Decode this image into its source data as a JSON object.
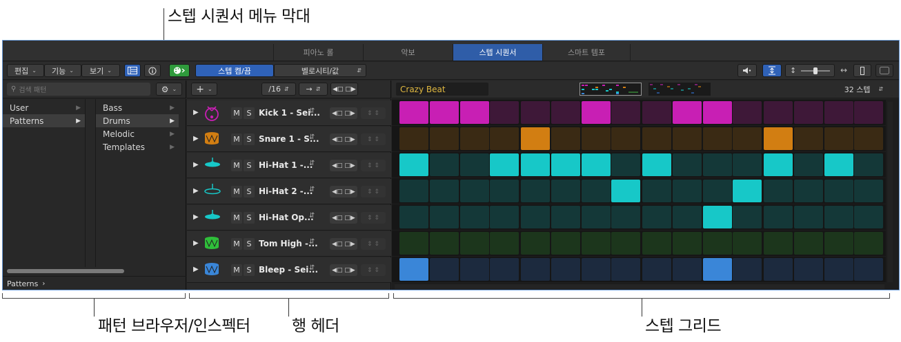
{
  "callouts": {
    "menubar": "스텝 시퀀서 메뉴 막대",
    "browser": "패턴 브라우저/인스펙터",
    "rowheader": "행 헤더",
    "grid": "스텝 그리드"
  },
  "tabs": [
    {
      "label": "피아노 롤",
      "active": false
    },
    {
      "label": "악보",
      "active": false
    },
    {
      "label": "스텝 시퀀서",
      "active": true
    },
    {
      "label": "스마트 템포",
      "active": false
    }
  ],
  "toolbar": {
    "edit": "편집",
    "functions": "기능",
    "view": "보기",
    "info_icon": "info-icon",
    "step_onoff": "스텝 켬/끔",
    "velocity": "벨로시티/값"
  },
  "browser": {
    "search_placeholder": "검색 패턴",
    "col1": [
      {
        "label": "User",
        "selected": false
      },
      {
        "label": "Patterns",
        "selected": true
      }
    ],
    "col2": [
      {
        "label": "Bass",
        "selected": false
      },
      {
        "label": "Drums",
        "selected": true
      },
      {
        "label": "Melodic",
        "selected": false
      },
      {
        "label": "Templates",
        "selected": false
      }
    ],
    "footer": "Patterns"
  },
  "rowheader_toolbar": {
    "add": "+",
    "step_rate": "/16",
    "arrow": "→"
  },
  "pattern": {
    "name": "Crazy Beat",
    "steps": "32 스텝"
  },
  "rows": [
    {
      "name": "Kick 1 - Sei...",
      "icon": "kick-drum-icon",
      "icon_color": "#c81fb4",
      "on": "#c81fb4",
      "off": "#3e1838",
      "steps": [
        1,
        1,
        1,
        0,
        0,
        0,
        1,
        0,
        0,
        1,
        1,
        0,
        0,
        0,
        0,
        0
      ]
    },
    {
      "name": "Snare 1 - S...",
      "icon": "snare-drum-icon",
      "icon_color": "#d27e12",
      "on": "#d27e12",
      "off": "#3a2a14",
      "steps": [
        0,
        0,
        0,
        0,
        1,
        0,
        0,
        0,
        0,
        0,
        0,
        0,
        1,
        0,
        0,
        0
      ]
    },
    {
      "name": "Hi-Hat 1 -...",
      "icon": "hihat-icon",
      "icon_color": "#17c8c8",
      "on": "#17c8c8",
      "off": "#143838",
      "steps": [
        1,
        0,
        0,
        1,
        1,
        1,
        1,
        0,
        1,
        0,
        0,
        0,
        1,
        0,
        1,
        0
      ]
    },
    {
      "name": "Hi-Hat 2 -...",
      "icon": "hihat-open-icon",
      "icon_color": "#17c8c8",
      "on": "#17c8c8",
      "off": "#143838",
      "steps": [
        0,
        0,
        0,
        0,
        0,
        0,
        0,
        1,
        0,
        0,
        0,
        1,
        0,
        0,
        0,
        0
      ]
    },
    {
      "name": "Hi-Hat Op...",
      "icon": "hihat-icon",
      "icon_color": "#17c8c8",
      "on": "#17c8c8",
      "off": "#143838",
      "steps": [
        0,
        0,
        0,
        0,
        0,
        0,
        0,
        0,
        0,
        0,
        1,
        0,
        0,
        0,
        0,
        0
      ]
    },
    {
      "name": "Tom High -...",
      "icon": "tom-drum-icon",
      "icon_color": "#2fbf3a",
      "on": "#2fbf3a",
      "off": "#1c361c",
      "steps": [
        0,
        0,
        0,
        0,
        0,
        0,
        0,
        0,
        0,
        0,
        0,
        0,
        0,
        0,
        0,
        0
      ]
    },
    {
      "name": "Bleep - Sei...",
      "icon": "bleep-drum-icon",
      "icon_color": "#3a86d8",
      "on": "#3a86d8",
      "off": "#1c2a3e",
      "steps": [
        1,
        0,
        0,
        0,
        0,
        0,
        0,
        0,
        0,
        0,
        1,
        0,
        0,
        0,
        0,
        0
      ]
    }
  ],
  "ms": {
    "m": "M",
    "s": "S"
  }
}
